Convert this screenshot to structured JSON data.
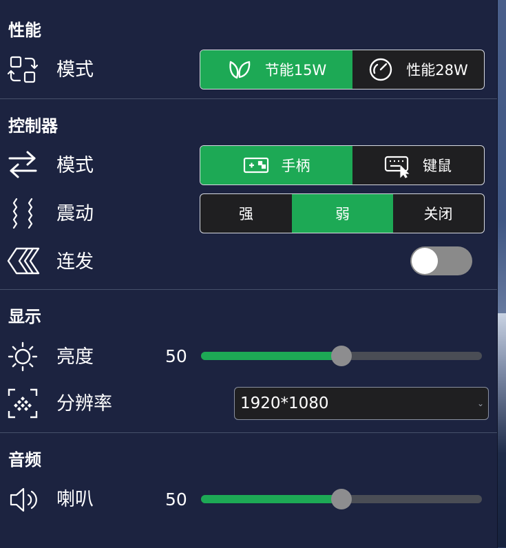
{
  "performance": {
    "title": "性能",
    "mode_label": "模式",
    "options": [
      {
        "label": "节能15W",
        "icon": "leaf-icon",
        "active": true
      },
      {
        "label": "性能28W",
        "icon": "speedometer-icon",
        "active": false
      }
    ]
  },
  "controller": {
    "title": "控制器",
    "mode_label": "模式",
    "mode_options": [
      {
        "label": "手柄",
        "icon": "gamepad-icon",
        "active": true
      },
      {
        "label": "键鼠",
        "icon": "keyboard-mouse-icon",
        "active": false
      }
    ],
    "vibration_label": "震动",
    "vibration_options": [
      {
        "label": "强",
        "active": false
      },
      {
        "label": "弱",
        "active": true
      },
      {
        "label": "关闭",
        "active": false
      }
    ],
    "turbo_label": "连发",
    "turbo_on": false
  },
  "display": {
    "title": "显示",
    "brightness_label": "亮度",
    "brightness_value": "50",
    "brightness_fraction": 0.5,
    "resolution_label": "分辨率",
    "resolution_value": "1920*1080"
  },
  "audio": {
    "title": "音频",
    "speaker_label": "喇叭",
    "speaker_value": "50",
    "speaker_fraction": 0.5
  },
  "colors": {
    "accent": "#1da955",
    "panel": "#1c2340",
    "track": "#4a4d55"
  }
}
